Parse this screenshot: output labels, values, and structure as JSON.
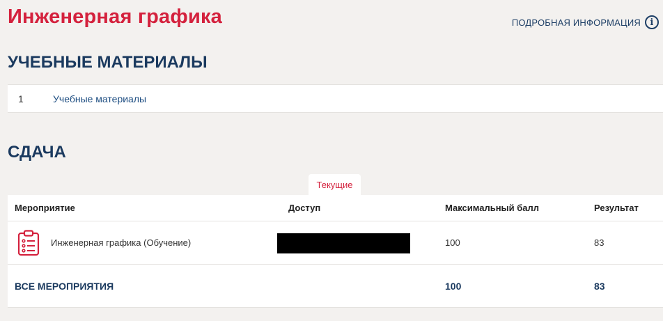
{
  "page": {
    "title": "Инженерная графика",
    "info_link_label": "ПОДРОБНАЯ ИНФОРМАЦИЯ",
    "info_icon_glyph": "i"
  },
  "materials": {
    "heading": "УЧЕБНЫЕ МАТЕРИАЛЫ",
    "items": [
      {
        "number": "1",
        "label": "Учебные материалы"
      }
    ]
  },
  "submission": {
    "heading": "СДАЧА",
    "tab_label": "Текущие",
    "table": {
      "columns": [
        "Мероприятие",
        "Доступ",
        "Максимальный балл",
        "Результат"
      ],
      "rows": [
        {
          "icon": "clipboard-list-icon",
          "name": "Инженерная графика (Обучение)",
          "access": "",
          "max_score": "100",
          "result": "83"
        }
      ],
      "total": {
        "label": "ВСЕ МЕРОПРИЯТИЯ",
        "max_score": "100",
        "result": "83"
      }
    }
  },
  "colors": {
    "accent_red": "#d4213d",
    "heading_navy": "#1b3a5f",
    "link_blue": "#1e4e82",
    "background": "#f3f1ef"
  }
}
